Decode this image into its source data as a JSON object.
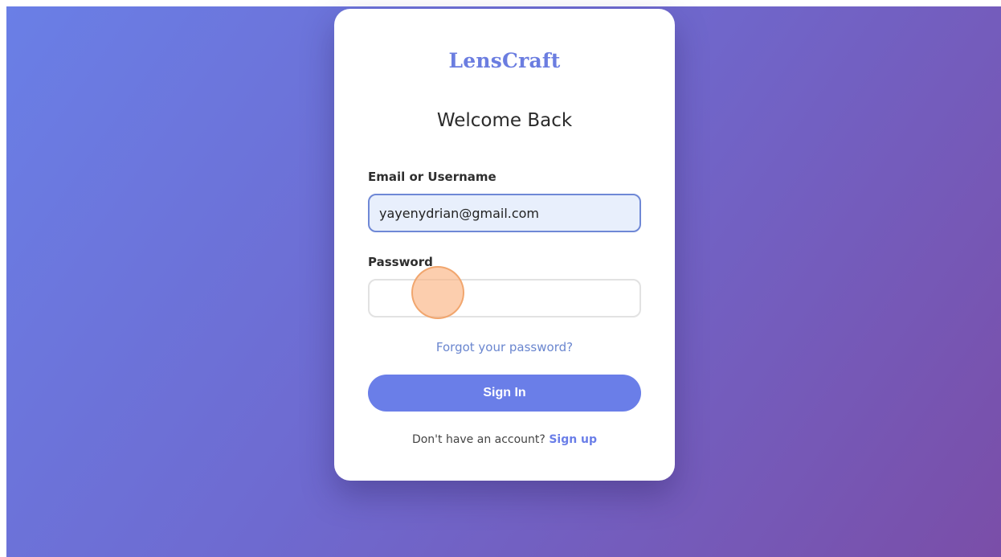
{
  "brand": {
    "name": "LensCraft"
  },
  "login": {
    "heading": "Welcome Back",
    "email_label": "Email or Username",
    "email_value": "yayenydrian@gmail.com",
    "password_label": "Password",
    "password_value": "",
    "forgot_link": "Forgot your password?",
    "signin_button": "Sign In",
    "signup_prompt": "Don't have an account?",
    "signup_link": "Sign up"
  },
  "colors": {
    "accent": "#6a7ee8",
    "brand": "#6b7de0",
    "link": "#6a86cf",
    "background_start": "#6a7fe6",
    "background_end": "#7a4ea8"
  }
}
